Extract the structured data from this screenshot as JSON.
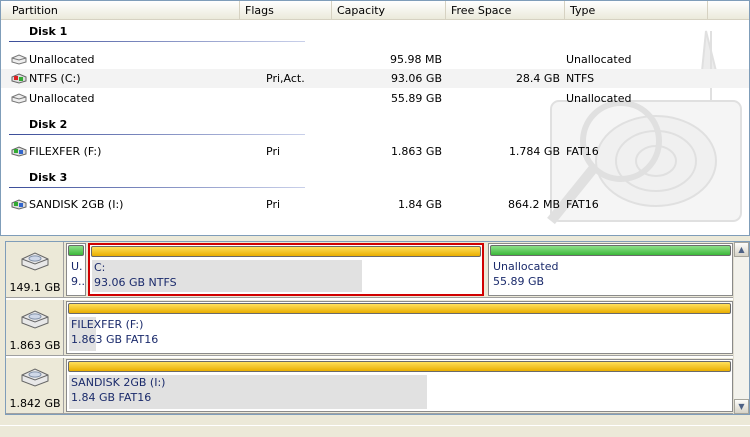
{
  "columns": {
    "partition": "Partition",
    "flags": "Flags",
    "capacity": "Capacity",
    "free_space": "Free Space",
    "type": "Type"
  },
  "disk_groups": [
    {
      "label": "Disk 1",
      "rows": [
        {
          "name": "Unallocated",
          "flags": "",
          "capacity": "95.98 MB",
          "free": "",
          "type": "Unallocated",
          "icon": "unallocated-icon"
        },
        {
          "name": "NTFS (C:)",
          "flags": "Pri,Act.",
          "capacity": "93.06 GB",
          "free": "28.4 GB",
          "type": "NTFS",
          "icon": "partition-icon"
        },
        {
          "name": "Unallocated",
          "flags": "",
          "capacity": "55.89 GB",
          "free": "",
          "type": "Unallocated",
          "icon": "unallocated-icon"
        }
      ]
    },
    {
      "label": "Disk 2",
      "rows": [
        {
          "name": "FILEXFER (F:)",
          "flags": "Pri",
          "capacity": "1.863 GB",
          "free": "1.784 GB",
          "type": "FAT16",
          "icon": "partition-icon"
        }
      ]
    },
    {
      "label": "Disk 3",
      "rows": [
        {
          "name": "SANDISK 2GB (I:)",
          "flags": "Pri",
          "capacity": "1.84 GB",
          "free": "864.2 MB",
          "type": "FAT16",
          "icon": "partition-icon"
        }
      ]
    }
  ],
  "disk_map": [
    {
      "size": "149.1 GB",
      "partitions": [
        {
          "line1": "U.",
          "line2": "9..",
          "bar": "green",
          "used_fraction": 0
        },
        {
          "line1": "C:",
          "line2": "93.06 GB  NTFS",
          "bar": "yellow",
          "used_fraction": 0.69,
          "selected": true
        },
        {
          "line1": "Unallocated",
          "line2": "55.89 GB",
          "bar": "green",
          "used_fraction": 0
        }
      ]
    },
    {
      "size": "1.863 GB",
      "partitions": [
        {
          "line1": "FILEXFER (F:)",
          "line2": "1.863 GB  FAT16",
          "bar": "yellow",
          "used_fraction": 0.04
        }
      ]
    },
    {
      "size": "1.842 GB",
      "partitions": [
        {
          "line1": "SANDISK 2GB (I:)",
          "line2": "1.84 GB  FAT16",
          "bar": "yellow",
          "used_fraction": 0.54
        }
      ]
    }
  ],
  "colors": {
    "selected_border": "#d00000",
    "unallocated_bar": "#3cb83a",
    "partition_bar": "#e9ae00",
    "partition_text": "#1a2a6b"
  }
}
